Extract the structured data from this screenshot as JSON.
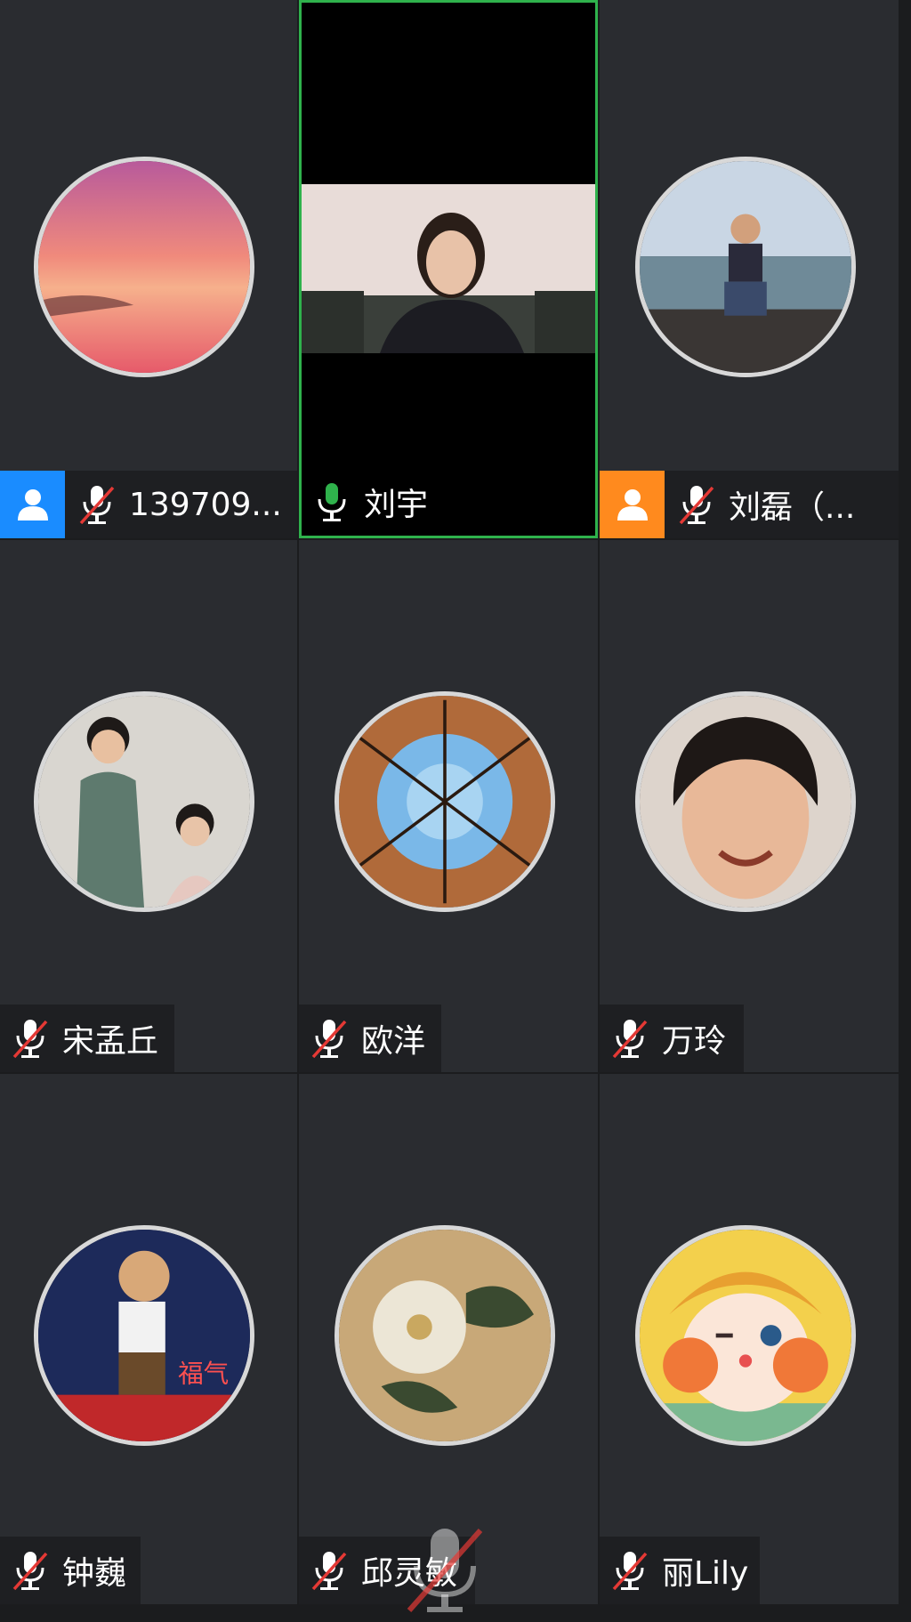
{
  "participants": [
    {
      "name": "139709...",
      "badge_color": "#1a8cff",
      "muted": true,
      "active": false
    },
    {
      "name": "刘宇",
      "badge_color": "",
      "muted": false,
      "active": true
    },
    {
      "name": "刘磊（...",
      "badge_color": "#ff8a1e",
      "muted": true,
      "active": false
    },
    {
      "name": "宋孟丘",
      "badge_color": "",
      "muted": true,
      "active": false
    },
    {
      "name": "欧洋",
      "badge_color": "",
      "muted": true,
      "active": false
    },
    {
      "name": "万玲",
      "badge_color": "",
      "muted": true,
      "active": false
    },
    {
      "name": "钟巍",
      "badge_color": "",
      "muted": true,
      "active": false
    },
    {
      "name": "邱灵敏",
      "badge_color": "",
      "muted": true,
      "active": false
    },
    {
      "name": "丽Lily",
      "badge_color": "",
      "muted": true,
      "active": false
    }
  ],
  "colors": {
    "active_border": "#2fb24c",
    "mic_on": "#2fb24c",
    "mic_muted_slash": "#e53935",
    "tile_bg": "#2a2c30"
  },
  "icons": {
    "host_badge": "person-icon",
    "mic": "microphone-icon",
    "mic_muted": "microphone-muted-icon"
  }
}
